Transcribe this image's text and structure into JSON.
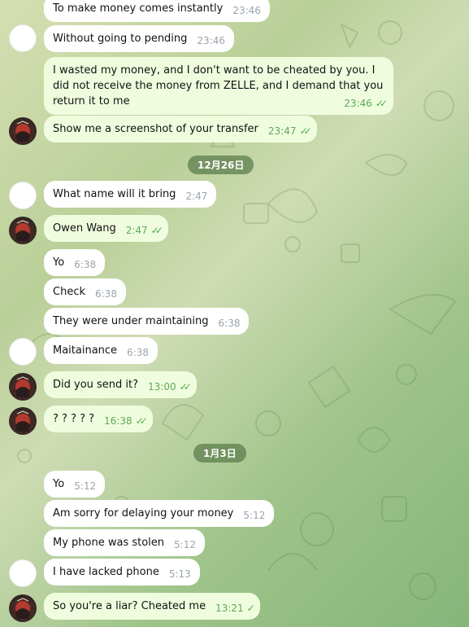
{
  "messages": [
    {
      "text": "To make  money comes instantly",
      "time": "23:46",
      "out": false,
      "avatar": "none"
    },
    {
      "text": "Without going to pending",
      "time": "23:46",
      "out": false,
      "avatar": "blank"
    },
    {
      "text": "I wasted my money, and I don't want to be cheated by you. I did not receive the money from ZELLE, and I demand that you return it to me",
      "time": "23:46",
      "out": true,
      "ticks": "✓✓",
      "avatar": "none"
    },
    {
      "text": "Show me a screenshot of your transfer",
      "time": "23:47",
      "out": true,
      "ticks": "✓✓",
      "avatar": "pic"
    },
    {
      "text": "What name will it bring",
      "time": "2:47",
      "out": false,
      "avatar": "blank"
    },
    {
      "text": "Owen Wang",
      "time": "2:47",
      "out": true,
      "ticks": "✓✓",
      "avatar": "pic"
    },
    {
      "text": "Yo",
      "time": "6:38",
      "out": false,
      "avatar": "none"
    },
    {
      "text": "Check",
      "time": "6:38",
      "out": false,
      "avatar": "none"
    },
    {
      "text": "They were under maintaining",
      "time": "6:38",
      "out": false,
      "avatar": "none"
    },
    {
      "text": "Maitainance",
      "time": "6:38",
      "out": false,
      "avatar": "blank"
    },
    {
      "text": "Did you send it?",
      "time": "13:00",
      "out": true,
      "ticks": "✓✓",
      "avatar": "pic"
    },
    {
      "text": "? ? ? ? ?",
      "time": "16:38",
      "out": true,
      "ticks": "✓✓",
      "avatar": "pic"
    },
    {
      "text": "Yo",
      "time": "5:12",
      "out": false,
      "avatar": "none"
    },
    {
      "text": "Am sorry for delaying your money",
      "time": "5:12",
      "out": false,
      "avatar": "none"
    },
    {
      "text": "My phone was stolen",
      "time": "5:12",
      "out": false,
      "avatar": "none"
    },
    {
      "text": "I have lacked phone",
      "time": "5:13",
      "out": false,
      "avatar": "blank"
    },
    {
      "text": "So you're a liar? Cheated me",
      "time": "13:21",
      "out": true,
      "ticks": "✓",
      "avatar": "pic"
    }
  ],
  "date_separators": [
    {
      "label": "12月26日"
    },
    {
      "label": "1月3日"
    }
  ]
}
